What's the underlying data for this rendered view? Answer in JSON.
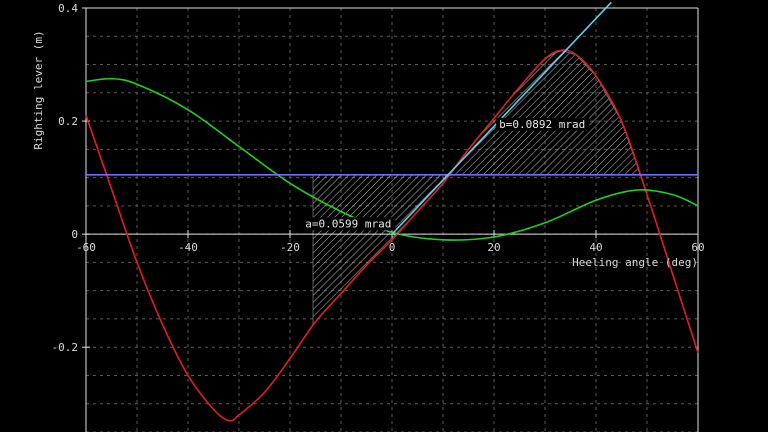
{
  "chart_data": {
    "type": "line",
    "xlabel": "Heeling angle (deg)",
    "ylabel": "Righting lever (m)",
    "xlim": [
      -60,
      60
    ],
    "ylim": [
      -0.35,
      0.4
    ],
    "x_ticks": [
      -60,
      -40,
      -20,
      0,
      20,
      40,
      60
    ],
    "x_tick_labels": [
      "-60",
      "-40",
      "-20",
      "0",
      "20",
      "40",
      "60"
    ],
    "y_ticks": [
      -0.2,
      0,
      0.2,
      0.4
    ],
    "y_tick_labels": [
      "-0.2",
      "0",
      "0.2",
      "0.4"
    ],
    "grid": true,
    "background": "#000000",
    "series": [
      {
        "color": "#e02020",
        "x": [
          -60,
          -55,
          -50,
          -45,
          -40,
          -35,
          -32,
          -30,
          -25,
          -20,
          -15,
          -10,
          -5,
          0,
          5,
          10,
          15,
          20,
          25,
          30,
          33,
          36,
          40,
          45,
          50,
          55,
          60
        ],
        "values": [
          0.21,
          0.08,
          -0.05,
          -0.16,
          -0.25,
          -0.31,
          -0.33,
          -0.32,
          -0.28,
          -0.22,
          -0.155,
          -0.105,
          -0.055,
          -0.01,
          0.04,
          0.09,
          0.15,
          0.205,
          0.26,
          0.31,
          0.325,
          0.318,
          0.28,
          0.2,
          0.07,
          -0.07,
          -0.21
        ]
      },
      {
        "color": "#20d020",
        "x": [
          -60,
          -55,
          -50,
          -40,
          -30,
          -20,
          -10,
          0,
          10,
          20,
          30,
          40,
          48,
          55,
          60
        ],
        "values": [
          0.27,
          0.275,
          0.265,
          0.22,
          0.155,
          0.09,
          0.04,
          0.003,
          -0.01,
          -0.005,
          0.02,
          0.06,
          0.078,
          0.07,
          0.05
        ]
      },
      {
        "color": "#7070ff",
        "x": [
          -60,
          60
        ],
        "values": [
          0.105,
          0.105
        ]
      },
      {
        "color": "#60d0f0",
        "x": [
          0,
          43
        ],
        "values": [
          0.0,
          0.41
        ]
      }
    ],
    "shaded_areas": [
      {
        "fill": "hatched",
        "from_x": -15.5,
        "to_x": 10.5,
        "between": "red curve and level 0.105"
      },
      {
        "fill": "hatched",
        "from_x": 10.5,
        "to_x": 48.5,
        "between": "level 0.105 and red curve"
      }
    ],
    "annotations": [
      {
        "text": "a=0.0599 mrad",
        "x": -17,
        "y": 0.012
      },
      {
        "text": "b=0.0892 mrad",
        "x": 21,
        "y": 0.188
      }
    ]
  }
}
